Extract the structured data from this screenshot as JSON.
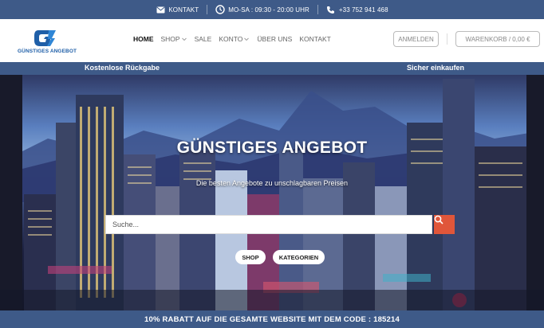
{
  "topbar": {
    "contact": "KONTAKT",
    "hours": "MO-SA : 09:30 - 20:00 UHR",
    "phone": "+33 752 941 468"
  },
  "logo": {
    "text": "GÜNSTIGES ANGEBOT"
  },
  "nav": {
    "items": [
      {
        "label": "HOME",
        "active": true,
        "dropdown": false
      },
      {
        "label": "SHOP",
        "active": false,
        "dropdown": true
      },
      {
        "label": "SALE",
        "active": false,
        "dropdown": false
      },
      {
        "label": "KONTO",
        "active": false,
        "dropdown": true
      },
      {
        "label": "ÜBER UNS",
        "active": false,
        "dropdown": false
      },
      {
        "label": "KONTAKT",
        "active": false,
        "dropdown": false
      }
    ]
  },
  "header": {
    "login_label": "ANMELDEN",
    "cart_label": "WARENKORB / 0,00 €"
  },
  "strip": {
    "left": "Kostenlose Rückgabe",
    "right": "Sicher einkaufen"
  },
  "hero": {
    "title": "GÜNSTIGES ANGEBOT",
    "subtitle": "Die besten Angebote zu unschlagbaren Preisen",
    "search_placeholder": "Suche...",
    "buttons": {
      "shop": "SHOP",
      "categories": "KATEGORIEN"
    }
  },
  "promo": {
    "text": "10% RABATT AUF DIE GESAMTE WEBSITE MIT DEM CODE : 185214"
  },
  "colors": {
    "brand_blue": "#3e5a88",
    "search_button": "#e0563a",
    "logo_blue": "#1f5fa8"
  }
}
